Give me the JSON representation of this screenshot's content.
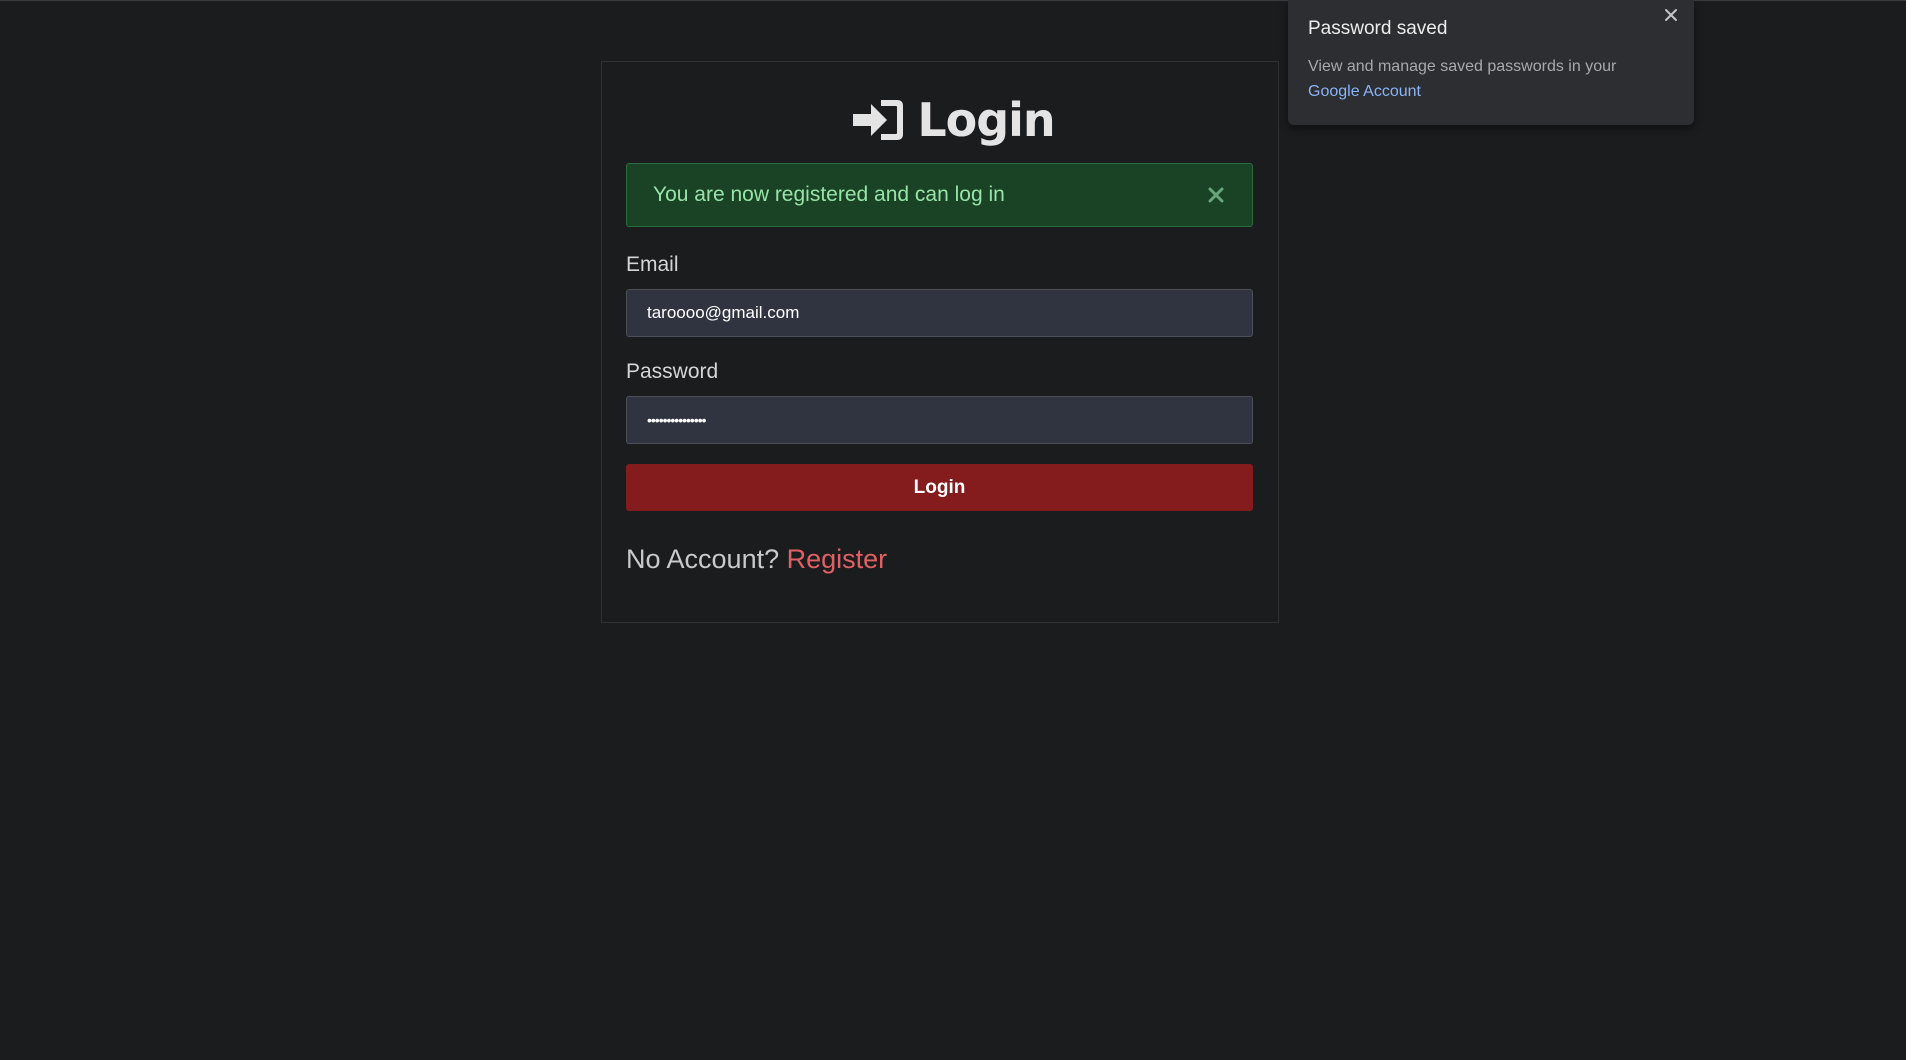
{
  "page": {
    "title": "Login",
    "alert_message": "You are now registered and can log in",
    "email_label": "Email",
    "email_value": "taroooo@gmail.com",
    "password_label": "Password",
    "password_mask": "•••••••••••••••",
    "login_button": "Login",
    "no_account_text": "No Account?",
    "register_link": "Register"
  },
  "popup": {
    "title": "Password saved",
    "text": "View and manage saved passwords in your",
    "link": "Google Account"
  },
  "icons": {
    "title_icon": "sign-in-icon",
    "alert_close": "close-icon",
    "popup_close": "close-icon"
  },
  "colors": {
    "background": "#1b1c1e",
    "alert_bg": "#1a4225",
    "alert_text": "#97e3a8",
    "input_bg": "#2f3440",
    "button": "#841b1c",
    "link": "#e06165",
    "popup_link": "#8ab4f8"
  }
}
